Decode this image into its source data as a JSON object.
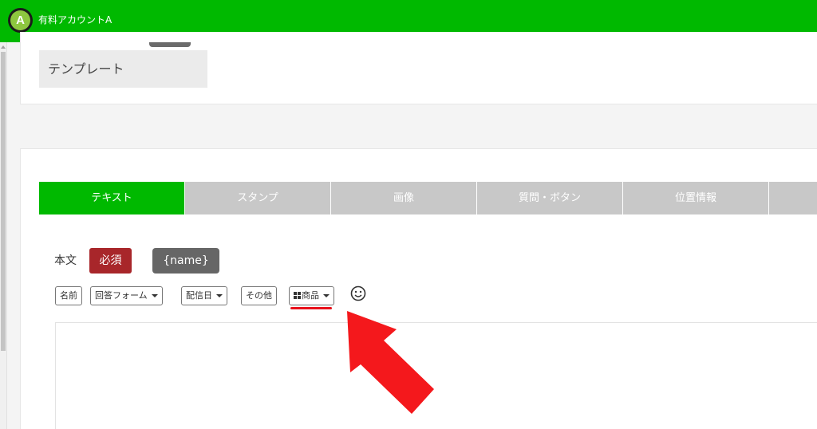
{
  "header": {
    "avatar_letter": "A",
    "account_name": "有料アカウントA",
    "brand_color": "#00b900"
  },
  "template_section": {
    "label": "テンプレート"
  },
  "tabs": [
    {
      "label": "テキスト",
      "active": true
    },
    {
      "label": "スタンプ",
      "active": false
    },
    {
      "label": "画像",
      "active": false
    },
    {
      "label": "質問・ボタン",
      "active": false
    },
    {
      "label": "位置情報",
      "active": false
    },
    {
      "label": "",
      "active": false
    }
  ],
  "message_body": {
    "label": "本文",
    "required_badge": "必須",
    "name_tag": "{name}"
  },
  "toolbar": {
    "name_button": "名前",
    "answer_form_button": "回答フォーム",
    "delivery_date_button": "配信日",
    "other_button": "その他",
    "product_button": "商品",
    "emoji_icon": "smiley-icon"
  },
  "annotation": {
    "arrow_color": "#f4181c",
    "underline_color": "#e8101a"
  }
}
